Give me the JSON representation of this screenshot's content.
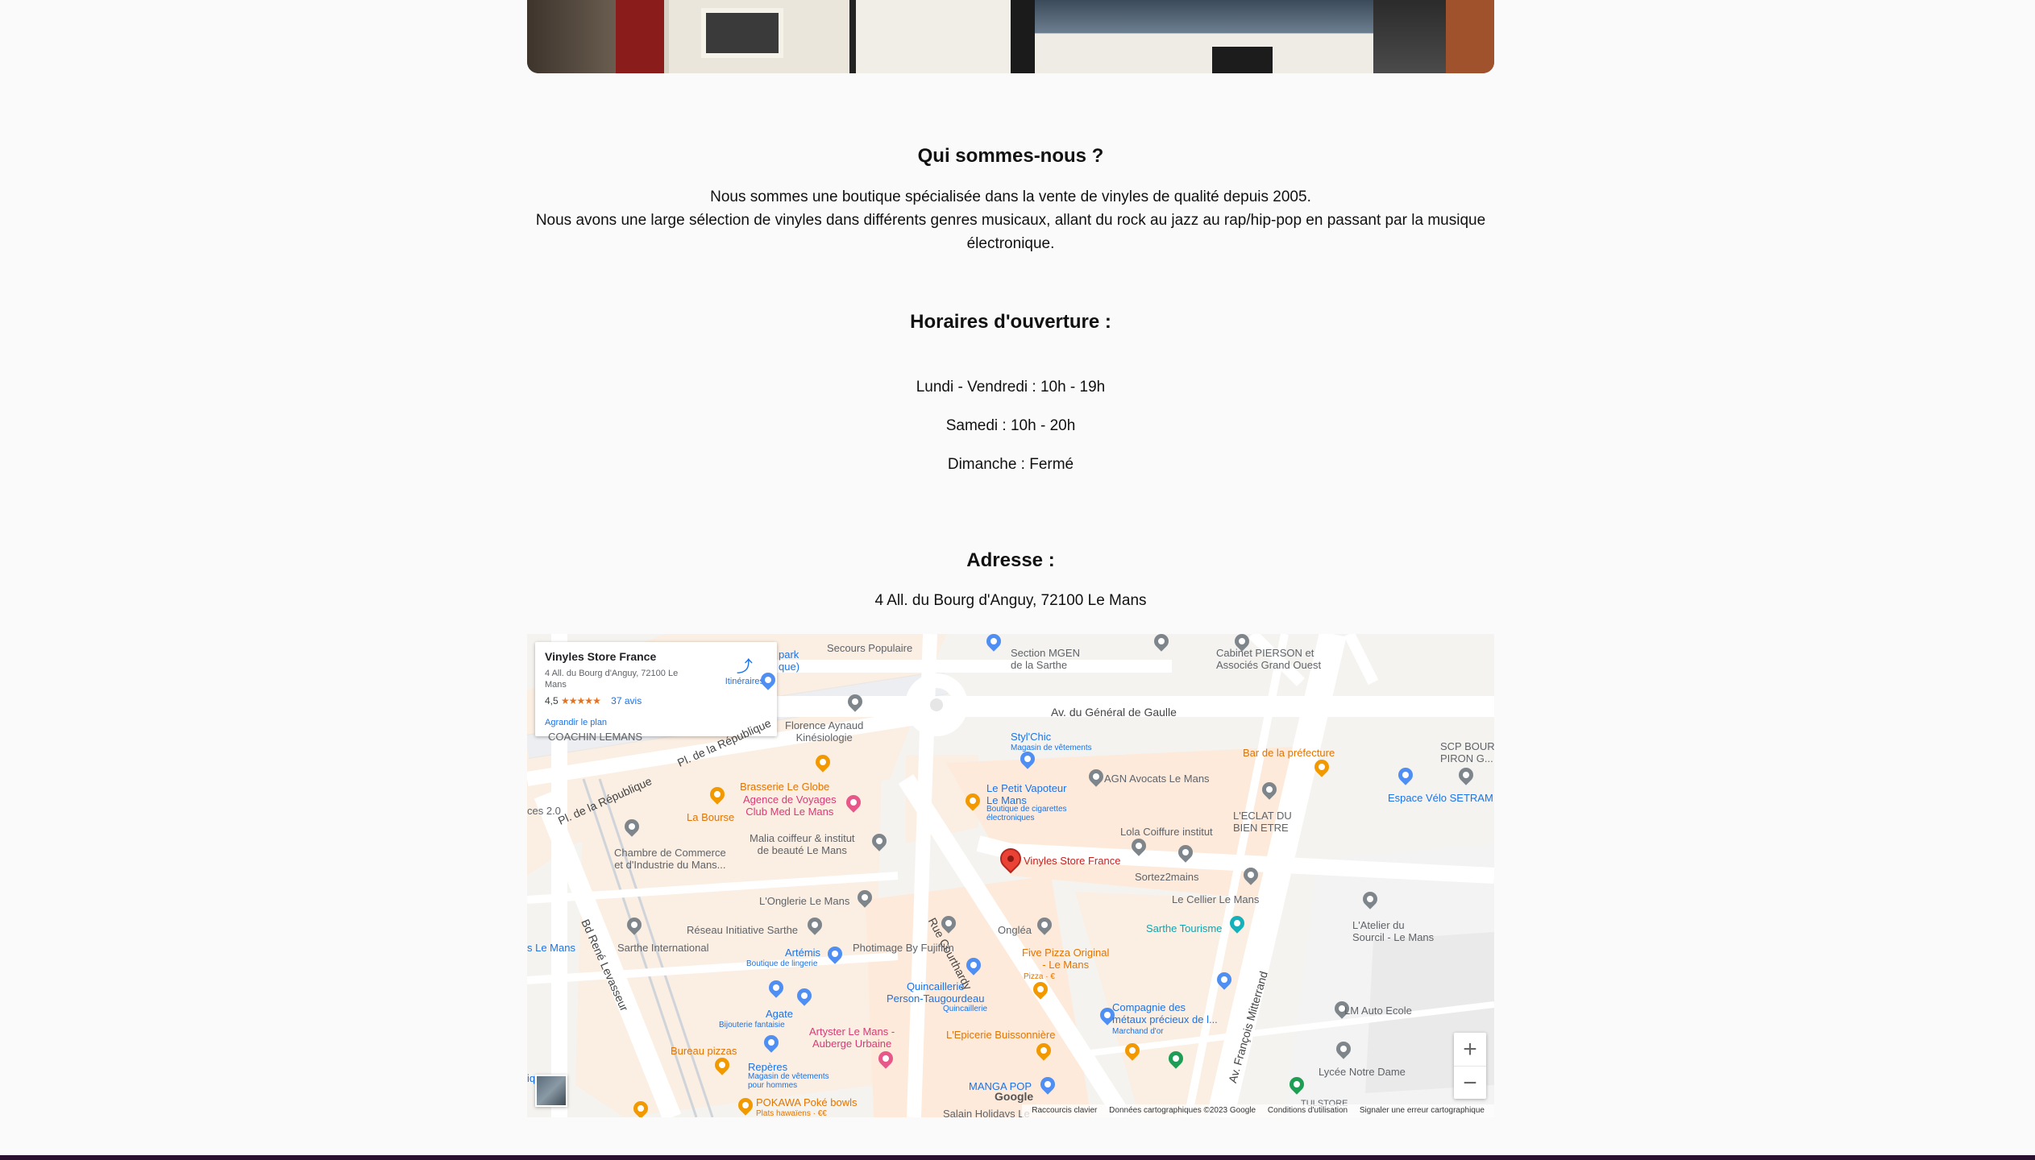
{
  "about": {
    "title": "Qui sommes-nous ?",
    "line1": "Nous sommes une boutique spécialisée dans la vente de vinyles de qualité depuis 2005.",
    "line2": "Nous avons une large sélection de vinyles dans différents genres musicaux, allant du rock au jazz au rap/hip-pop en passant par la musique électronique."
  },
  "hours": {
    "title": "Horaires d'ouverture :",
    "weekdays": "Lundi - Vendredi : 10h - 19h",
    "saturday": "Samedi : 10h - 20h",
    "sunday": "Dimanche : Fermé"
  },
  "address": {
    "title": "Adresse :",
    "text": "4 All. du Bourg d'Anguy, 72100 Le Mans"
  },
  "map": {
    "card": {
      "name": "Vinyles Store France",
      "address": "4 All. du Bourg d'Anguy, 72100 Le Mans",
      "rating": "4,5",
      "stars": "★★★★★",
      "reviews": "37 avis",
      "route_label": "Itinéraires",
      "enlarge": "Agrandir le plan"
    },
    "marker_label": "Vinyles Store France",
    "zoom_in": "+",
    "zoom_out": "−",
    "google": "Google",
    "attribution": {
      "shortcuts": "Raccourcis clavier",
      "data": "Données cartographiques ©2023 Google",
      "terms": "Conditions d'utilisation",
      "report": "Signaler une erreur cartographique"
    },
    "labels": {
      "secours": "Secours Populaire",
      "mgen": "Section MGEN\nde la Sarthe",
      "pierson": "Cabinet PIERSON et\nAssociés Grand Ouest",
      "gaulle": "Av. du Général de Gaulle",
      "florence": "Florence Aynaud\nKinésiologie",
      "coach": "COACHIN LEMANS",
      "park": "park\nque)",
      "stylchic": "Styl'Chic",
      "stylchic_sub": "Magasin de vêtements",
      "bar_pref": "Bar de la préfecture",
      "scp": "SCP BOUR\nPIRON G...",
      "velo": "Espace Vélo SETRAM",
      "pl_rep1": "Pl. de la République",
      "pl_rep2": "Pl. de la République",
      "brasserie": "Brasserie Le Globe",
      "agence": "Agence de Voyages\nClub Med Le Mans",
      "bourse": "La Bourse",
      "petit_vap": "Le Petit Vapoteur\nLe Mans",
      "petit_vap_sub": "Boutique de cigarettes\nélectroniques",
      "agn": "AGN Avocats Le Mans",
      "eclat": "L'ECLAT DU\nBIEN ETRE",
      "lola": "Lola Coiffure institut",
      "ces": "ces 2.0",
      "chambre": "Chambre de Commerce\net d'Industrie du Mans...",
      "malia": "Malia coiffeur & institut\nde beauté Le Mans",
      "sortez": "Sortez2mains",
      "cellier": "Le Cellier Le Mans",
      "onglerie": "L'Onglerie Le Mans",
      "atelier": "L'Atelier du\nSourcil - Le Mans",
      "courthardy": "Rue Courthardy",
      "reseau": "Réseau Initiative Sarthe",
      "onglea": "Ongléa",
      "sarthe_tour": "Sarthe Tourisme",
      "sarthe_int": "Sarthe International",
      "photimage": "Photimage By Fujifilm",
      "artemis": "Artémis",
      "artemis_sub": "Boutique de lingerie",
      "five_pizza": "Five Pizza Original\n- Le Mans",
      "five_pizza_sub": "Pizza · €",
      "mitterrand": "Av. François Mitterrand",
      "les_mans": "s Le Mans",
      "levasseur": "Bd René Levasseur",
      "quinc": "Quincaillerie\nPerson-Taugourdeau",
      "quinc_sub": "Quincaillerie",
      "agate": "Agate",
      "agate_sub": "Bijouterie fantaisie",
      "artyster": "Artyster Le Mans -\nAuberge Urbaine",
      "epicerie": "L'Epicerie Buissonnière",
      "compagnie": "Compagnie des\nmétaux précieux de l...",
      "compagnie_sub": "Marchand d'or",
      "lm_auto": "LM Auto Ecole",
      "bureau": "Bureau pizzas",
      "reperes": "Repères",
      "reperes_sub": "Magasin de vêtements\npour hommes",
      "lycee": "Lycée Notre Dame",
      "iq_mans": "iq Mans",
      "manga": "MANGA POP",
      "pokawa": "POKAWA Poké bowls",
      "pokawa_sub": "Plats hawaïens · €€",
      "salain": "Salain Holidays Le",
      "tulstore": "TULSTORE"
    }
  }
}
